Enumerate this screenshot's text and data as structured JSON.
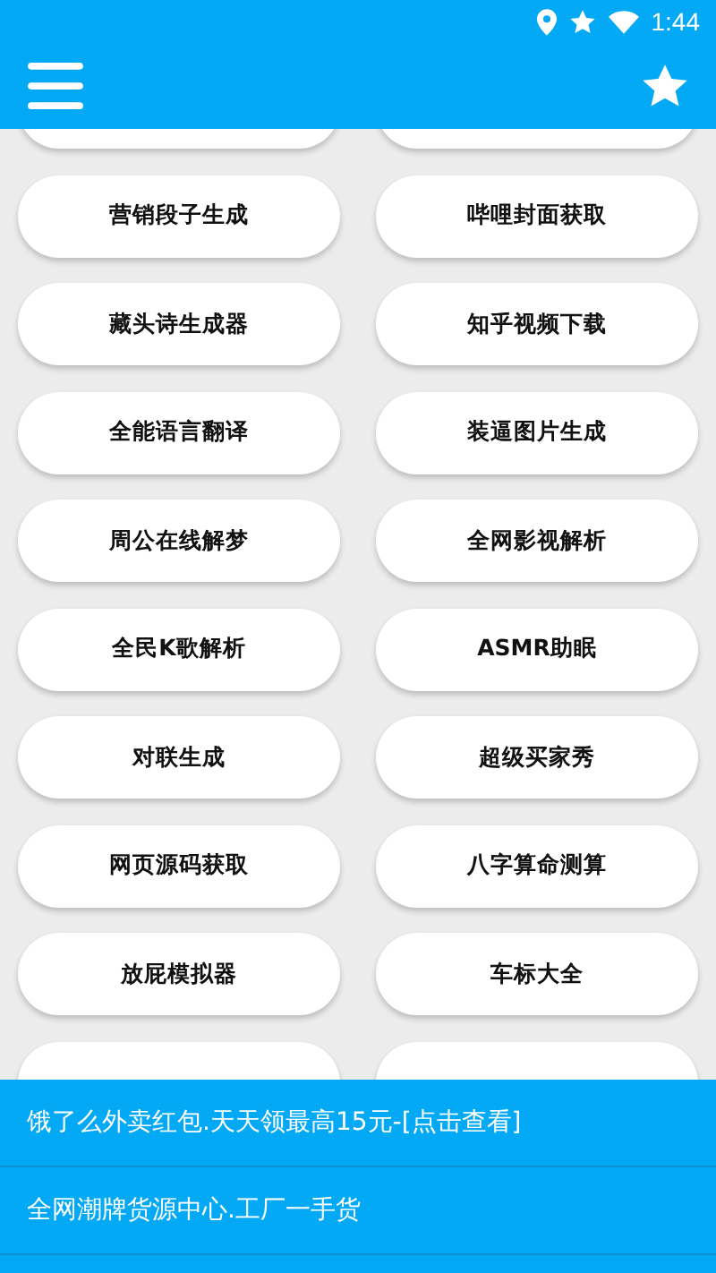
{
  "status_bar": {
    "time": "1:44"
  },
  "tools": [
    {
      "kind": "cut"
    },
    {
      "kind": "cut"
    },
    {
      "kind": "label",
      "label": "营销段子生成"
    },
    {
      "kind": "label",
      "label": "哔哩封面获取"
    },
    {
      "kind": "label",
      "label": "藏头诗生成器"
    },
    {
      "kind": "label",
      "label": "知乎视频下载"
    },
    {
      "kind": "label",
      "label": "全能语言翻译"
    },
    {
      "kind": "label",
      "label": "装逼图片生成"
    },
    {
      "kind": "label",
      "label": "周公在线解梦"
    },
    {
      "kind": "label",
      "label": "全网影视解析"
    },
    {
      "kind": "label",
      "label": "全民K歌解析"
    },
    {
      "kind": "label",
      "label": "ASMR助眠"
    },
    {
      "kind": "label",
      "label": "对联生成"
    },
    {
      "kind": "label",
      "label": "超级买家秀"
    },
    {
      "kind": "label",
      "label": "网页源码获取"
    },
    {
      "kind": "label",
      "label": "八字算命测算"
    },
    {
      "kind": "label",
      "label": "放屁模拟器"
    },
    {
      "kind": "label",
      "label": "车标大全"
    },
    {
      "kind": "cut"
    },
    {
      "kind": "cut"
    }
  ],
  "ads": [
    {
      "text": "饿了么外卖红包.天天领最高15元-[点击查看]"
    },
    {
      "text": "全网潮牌货源中心.工厂一手货"
    }
  ]
}
